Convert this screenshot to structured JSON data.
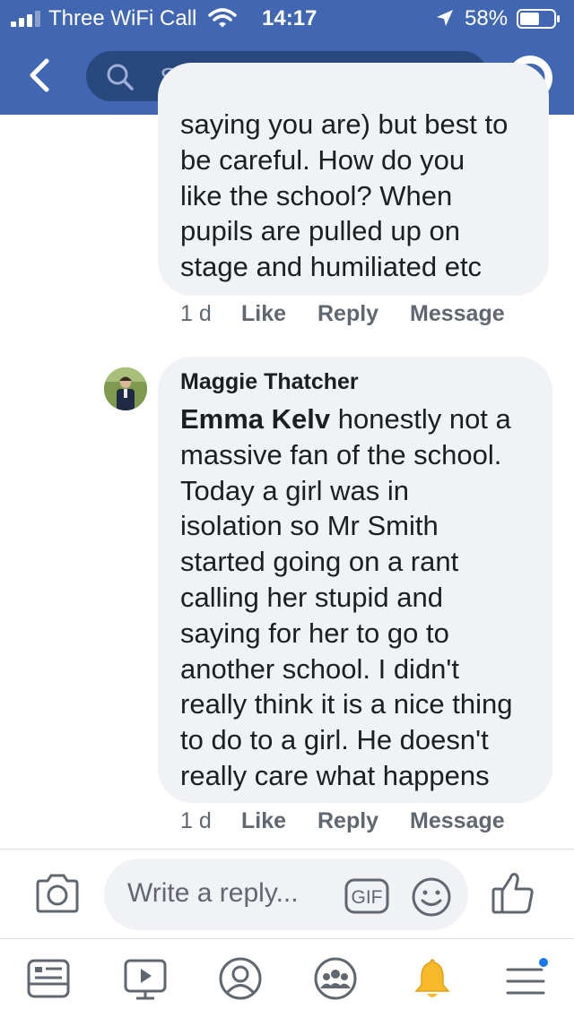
{
  "status_bar": {
    "carrier": "Three WiFi Call",
    "time": "14:17",
    "battery": "58%",
    "battery_level": 0.58
  },
  "header": {
    "search_placeholder": "Search",
    "icons": [
      "back-arrow-icon",
      "search-icon",
      "messenger-icon"
    ]
  },
  "comments": [
    {
      "lines": [
        "saying you are) but best to",
        "be careful.  How do you",
        "like the school? When",
        "pupils are pulled up on",
        "stage and humiliated etc"
      ],
      "time": "1 d",
      "like": "Like",
      "reply": "Reply",
      "message": "Message"
    },
    {
      "author": "Maggie Thatcher",
      "mention": "Emma Kelv",
      "first_line": " honestly not a",
      "lines": [
        "massive fan of the school.",
        "Today a girl was in",
        "isolation so Mr Smith",
        "started going on a rant",
        "calling her stupid and",
        "saying for her to go to",
        "another school. I didn't",
        "really think it is a nice thing",
        "to do to a girl. He doesn't",
        "really care what happens"
      ],
      "time": "1 d",
      "like": "Like",
      "reply": "Reply",
      "message": "Message"
    }
  ],
  "reply_bar": {
    "placeholder": "Write a reply...",
    "gif_label": "GIF",
    "icons": [
      "camera-icon",
      "gif-icon",
      "emoji-icon",
      "thumbs-up-icon"
    ]
  },
  "bottom_nav": {
    "items": [
      "news-feed-icon",
      "watch-icon",
      "profile-icon",
      "groups-icon",
      "notifications-icon",
      "menu-icon"
    ],
    "colors": {
      "notifications": "#f7b928",
      "badge": "#1877f2",
      "icon": "#606770"
    }
  },
  "colors": {
    "brand": "#4267b2",
    "search_bg": "#29487d",
    "bubble": "#f0f2f5"
  }
}
